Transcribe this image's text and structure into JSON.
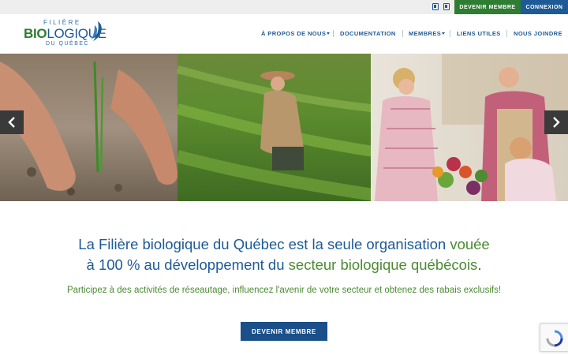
{
  "topbar": {
    "social_icons": [
      "facebook-icon",
      "linkedin-icon"
    ],
    "member_button": "DEVENIR MEMBRE",
    "login_button": "CONNEXION",
    "colors": {
      "member_bg": "#2e7d32",
      "login_bg": "#1e5a96",
      "bar_bg": "#eeeeee"
    }
  },
  "logo": {
    "line1": "FILIÈRE",
    "line2_bio": "BIO",
    "line2_rest": "LOGIQUE",
    "line3": "DU QUÉBEC"
  },
  "nav": {
    "items": [
      {
        "label": "À PROPOS DE NOUS",
        "has_dropdown": true
      },
      {
        "label": "DOCUMENTATION",
        "has_dropdown": false
      },
      {
        "label": "MEMBRES",
        "has_dropdown": true
      },
      {
        "label": "LIENS UTILES",
        "has_dropdown": false
      },
      {
        "label": "NOUS JOINDRE",
        "has_dropdown": false
      }
    ],
    "color": "#1e5a96"
  },
  "hero": {
    "slides_visible": [
      "hands-planting-seedling-photo",
      "woman-tending-crops-photo",
      "market-vegetable-stand-photo"
    ],
    "prev_icon": "chevron-left-icon",
    "next_icon": "chevron-right-icon"
  },
  "main": {
    "headline_part1": "La Filière biologique du Québec est la seule organisation ",
    "headline_part2": "vouée",
    "headline_part3": "à 100 %",
    "headline_part4": " au développement du ",
    "headline_part5": "secteur biologique québécois",
    "headline_part6": ".",
    "subline": "Participez à des activités de réseautage, influencez l'avenir de votre secteur et obtenez des rabais exclusifs!",
    "cta_label": "DEVENIR MEMBRE",
    "colors": {
      "blue": "#1e5a96",
      "green": "#4a8b32",
      "cta_bg": "#1a4f8a"
    }
  },
  "recaptcha": {
    "icon": "recaptcha-icon"
  }
}
